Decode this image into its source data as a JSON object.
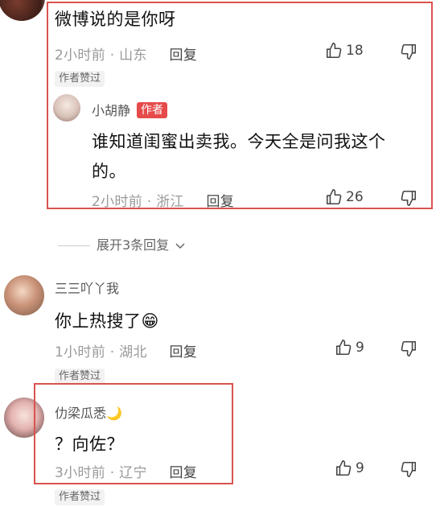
{
  "comment1": {
    "text": "微博说的是你呀",
    "time": "2小时前",
    "location": "山东",
    "reply_label": "回复",
    "likes": "18",
    "author_liked": "作者赞过"
  },
  "reply1": {
    "name": "小胡静",
    "author_tag": "作者",
    "text_line1": "谁知道闺蜜出卖我。今天全是问我这个",
    "text_line2": "的。",
    "time": "2小时前",
    "location": "浙江",
    "reply_label": "回复",
    "likes": "26"
  },
  "expand_replies": "展开3条回复",
  "comment2": {
    "name": "三三吖丫我",
    "text": "你上热搜了😁",
    "time": "1小时前",
    "location": "湖北",
    "reply_label": "回复",
    "likes": "9",
    "author_liked": "作者赞过"
  },
  "comment3": {
    "name": "仂梁瓜悉🌙",
    "text": "？向佐？",
    "time": "3小时前",
    "location": "辽宁",
    "reply_label": "回复",
    "likes": "9",
    "author_liked": "作者赞过"
  },
  "colors": {
    "highlight_box": "#d9534f",
    "author_tag": "#e64a4a",
    "meta_gray": "#9a9a9a"
  }
}
